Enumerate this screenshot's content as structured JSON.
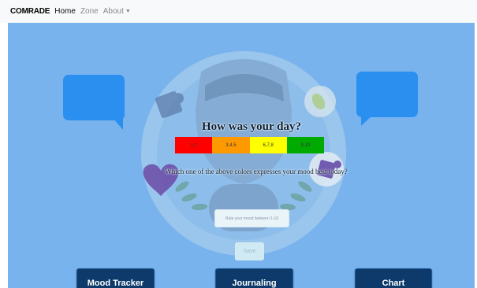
{
  "navbar": {
    "brand": "COMRADE",
    "links": [
      "Home",
      "Zone"
    ],
    "dropdown": {
      "label": "About",
      "caret": "▼"
    }
  },
  "mood_card": {
    "title": "How was your day?",
    "scale": [
      {
        "label": "1,2",
        "color": "#ff0000"
      },
      {
        "label": "3,4,5",
        "color": "#ff9900"
      },
      {
        "label": "6,7,8",
        "color": "#ffff00"
      },
      {
        "label": "9,10",
        "color": "#00aa00"
      }
    ],
    "question": "Which one of the above colors expresses your mood best today?",
    "input": {
      "placeholder": "Rate your mood between 1-10",
      "value": ""
    },
    "save_label": "Save"
  },
  "actions": {
    "mood_tracker": "Mood Tracker",
    "journaling": "Journaling",
    "chart": "Chart"
  },
  "colors": {
    "background": "#79b3ed",
    "accent_dark": "#0d3a6b",
    "speech_bubble": "#2b8ff0"
  },
  "decor_icons": [
    "speech-bubble-icon",
    "puzzle-icon",
    "heart-icon",
    "lightbulb-icon",
    "person-illustration"
  ]
}
